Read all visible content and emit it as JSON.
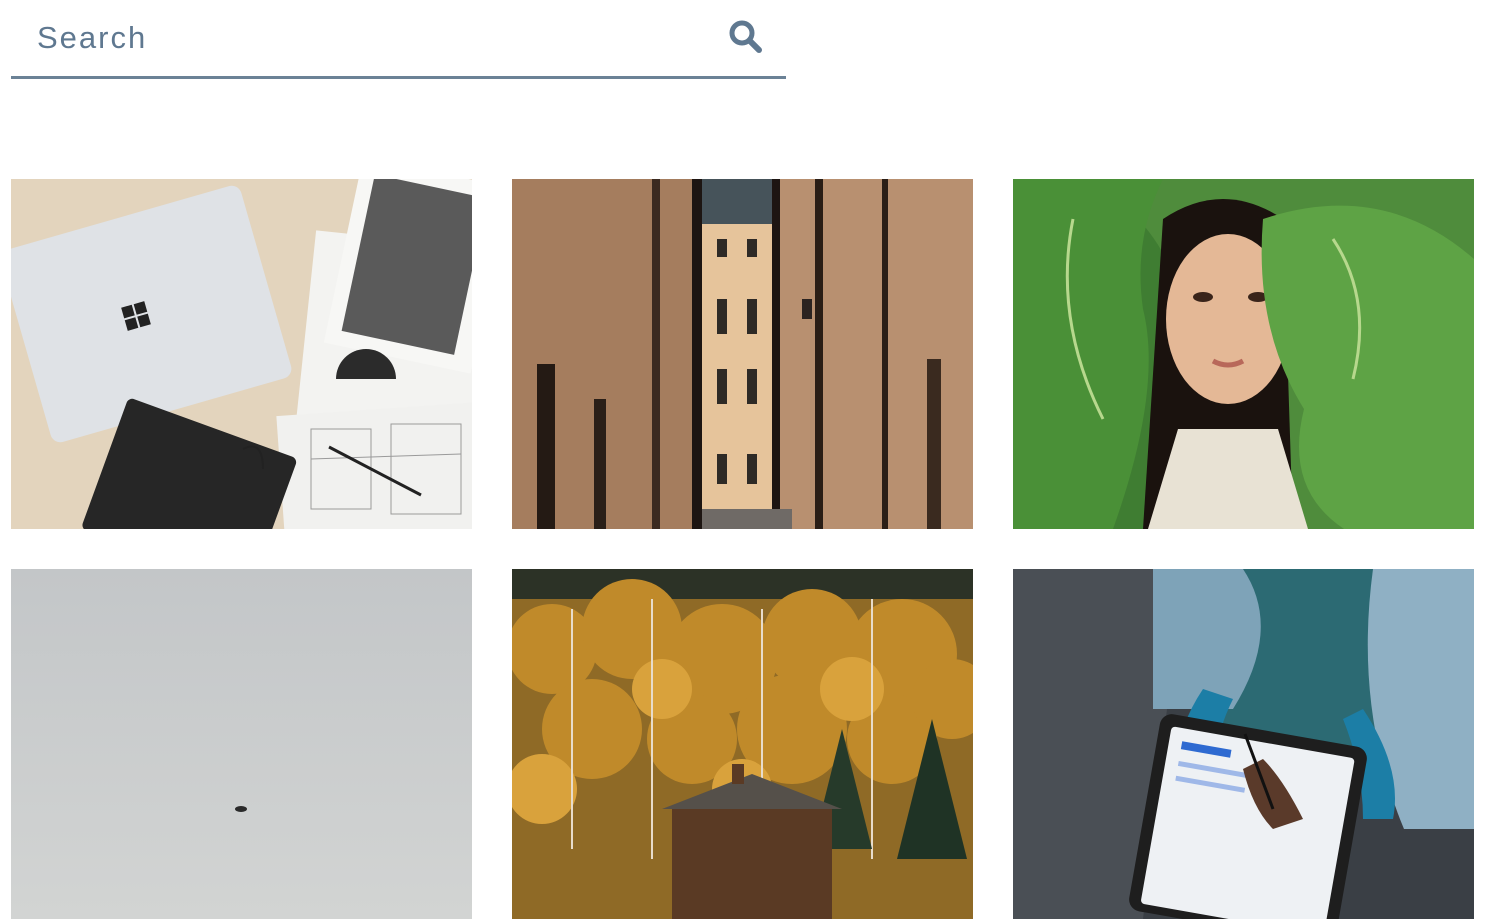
{
  "search": {
    "placeholder": "Search",
    "icon": "search-icon",
    "accent_color": "#6b8296"
  },
  "gallery": {
    "photos": [
      {
        "subject": "laptop-and-notebook-on-desk"
      },
      {
        "subject": "narrow-alley-buildings"
      },
      {
        "subject": "woman-in-leaves"
      },
      {
        "subject": "grey-sky-landscape"
      },
      {
        "subject": "autumn-forest-cabin"
      },
      {
        "subject": "person-with-tablet"
      }
    ]
  }
}
